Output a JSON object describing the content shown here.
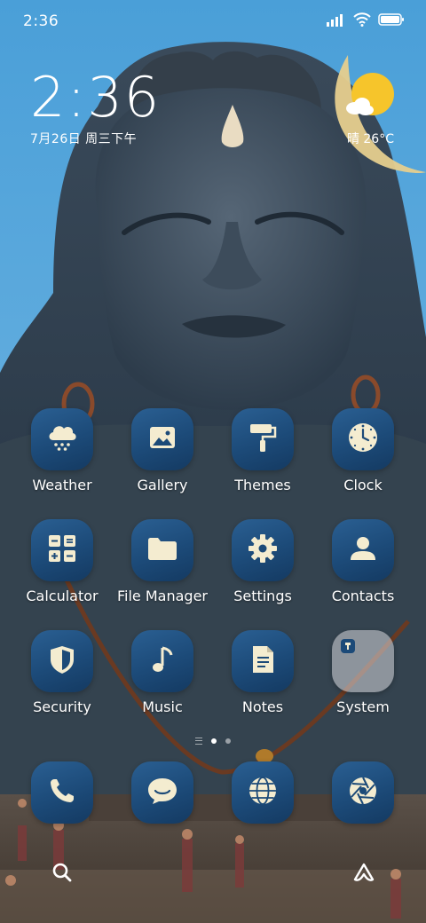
{
  "status_bar": {
    "time": "2:36",
    "icons": [
      "signal-icon",
      "wifi-icon",
      "battery-icon"
    ]
  },
  "clock_widget": {
    "time": "2:36",
    "date": "7月26日 周三下午"
  },
  "weather_widget": {
    "temperature": "晴 26°C",
    "icon": "partly-sunny-icon"
  },
  "apps": [
    {
      "label": "Weather",
      "icon": "cloud-snow-icon"
    },
    {
      "label": "Gallery",
      "icon": "image-icon"
    },
    {
      "label": "Themes",
      "icon": "paint-roller-icon"
    },
    {
      "label": "Clock",
      "icon": "clock-icon"
    },
    {
      "label": "Calculator",
      "icon": "calculator-icon"
    },
    {
      "label": "File Manager",
      "icon": "folder-icon"
    },
    {
      "label": "Settings",
      "icon": "gear-icon"
    },
    {
      "label": "Contacts",
      "icon": "person-icon"
    },
    {
      "label": "Security",
      "icon": "shield-icon"
    },
    {
      "label": "Music",
      "icon": "music-note-icon"
    },
    {
      "label": "Notes",
      "icon": "note-icon"
    },
    {
      "label": "System",
      "icon": "folder-icon"
    }
  ],
  "page_indicator": {
    "pages": 2,
    "current": 1
  },
  "dock": [
    {
      "name": "phone",
      "icon": "phone-icon"
    },
    {
      "name": "messages",
      "icon": "chat-bubble-icon"
    },
    {
      "name": "browser",
      "icon": "globe-icon"
    },
    {
      "name": "camera",
      "icon": "aperture-icon"
    }
  ],
  "bottom_bar": {
    "left_icon": "search-icon",
    "right_icon": "triangle-app-icon"
  },
  "colors": {
    "sky": "#5aa7dc",
    "statue": "#2f3e4e",
    "tile": "#1c4a78",
    "icon_fill": "#f4ecd0",
    "sun": "#f6c52b",
    "moon": "#e6cf8e"
  }
}
